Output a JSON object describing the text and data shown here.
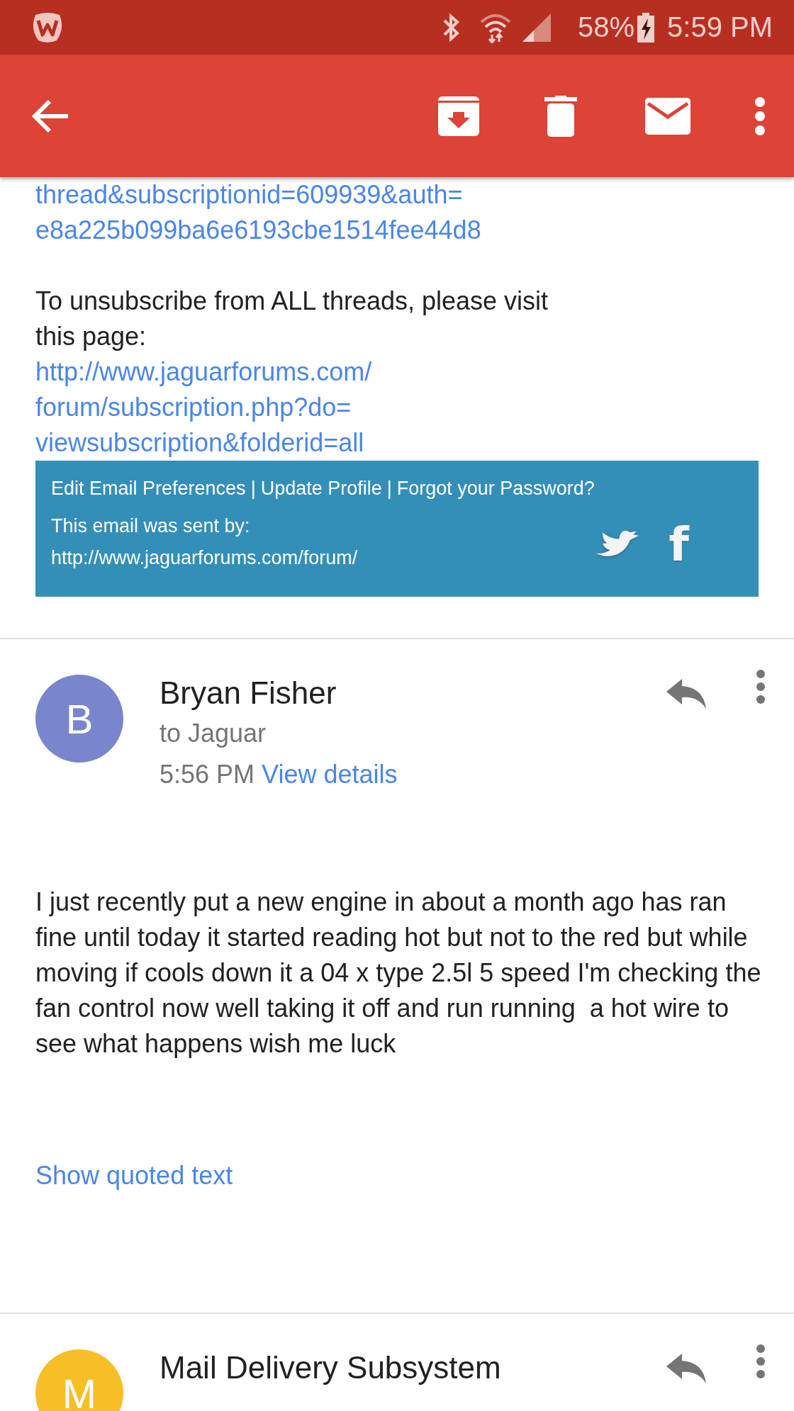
{
  "status_bar": {
    "battery_percent": "58%",
    "time": "5:59 PM"
  },
  "previous_message": {
    "link_lines": [
      "thread&subscriptionid=609939&auth=",
      "e8a225b099ba6e6193cbe1514fee44d8"
    ],
    "unsubscribe_text": "To unsubscribe from ALL threads, please visit this page:",
    "unsubscribe_link_lines": [
      "http://www.jaguarforums.com/",
      "forum/subscription.php?do=",
      "viewsubscription&folderid=all"
    ],
    "footer": {
      "links": [
        "Edit Email Preferences",
        "Update Profile",
        "Forgot your Password?"
      ],
      "separator": "|",
      "sent_by_label": "This email was sent by:",
      "sent_by_url": "http://www.jaguarforums.com/forum/",
      "facebook_glyph": "f"
    }
  },
  "messages": [
    {
      "sender": "Bryan Fisher",
      "avatar_letter": "B",
      "color": "#7986cb",
      "recipient": "to Jaguar",
      "time": "5:56 PM",
      "details_link": "View details",
      "body": "I just recently put a new engine in about a month ago has ran fine until today it started reading hot but not to the red but while moving if cools down it a 04 x type 2.5l 5 speed I'm checking the fan control now well taking it off and run running  a hot wire to see what happens wish me luck",
      "quoted_link": "Show quoted text"
    },
    {
      "sender": "Mail Delivery Subsystem",
      "avatar_letter": "M",
      "color": "#f6bf26"
    }
  ]
}
